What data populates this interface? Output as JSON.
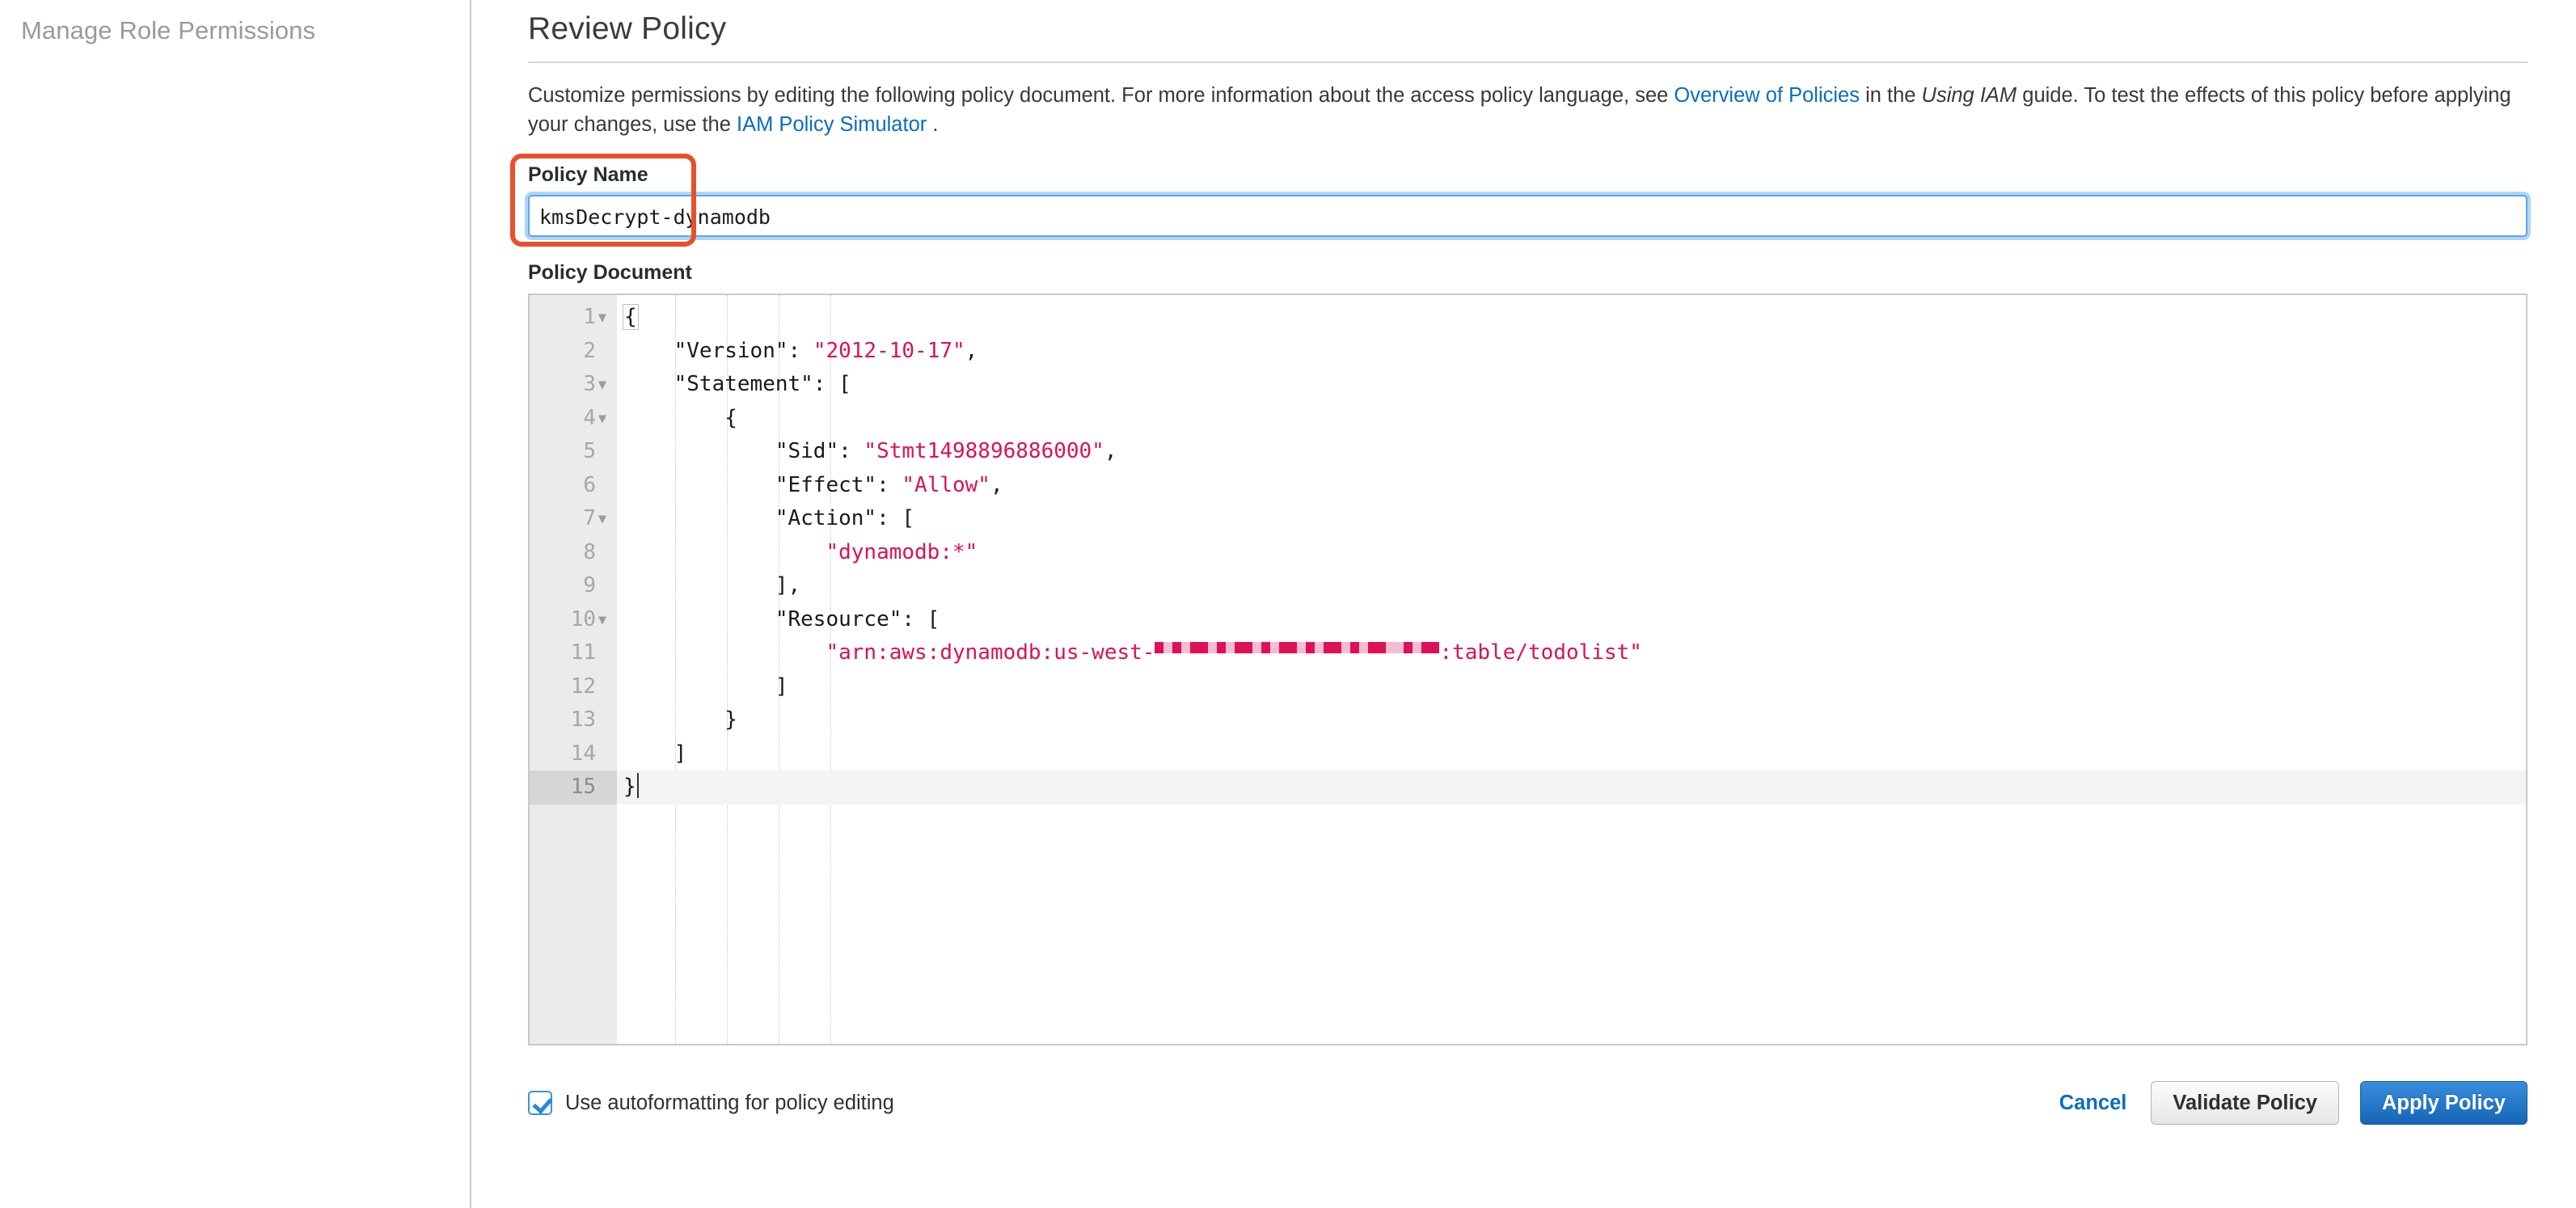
{
  "sidebar": {
    "title": "Manage Role Permissions"
  },
  "header": {
    "title": "Review Policy"
  },
  "description": {
    "part1": "Customize permissions by editing the following policy document. For more information about the access policy language, see ",
    "link1": "Overview of Policies",
    "part2": " in the ",
    "italic1": "Using IAM",
    "part3": " guide. To test the effects of this policy before applying your changes, use the ",
    "link2": "IAM Policy Simulator",
    "part4": " ."
  },
  "policy_name": {
    "label": "Policy Name",
    "value": "kmsDecrypt-dynamodb",
    "placeholder": "Policy Name"
  },
  "policy_document": {
    "label": "Policy Document",
    "lines": [
      {
        "n": "1",
        "fold": true,
        "active": false,
        "indent": 0,
        "pre": "{",
        "str": "",
        "post": ""
      },
      {
        "n": "2",
        "fold": false,
        "active": false,
        "indent": 1,
        "pre": "\"Version\": ",
        "str": "\"2012-10-17\"",
        "post": ","
      },
      {
        "n": "3",
        "fold": true,
        "active": false,
        "indent": 1,
        "pre": "\"Statement\": [",
        "str": "",
        "post": ""
      },
      {
        "n": "4",
        "fold": true,
        "active": false,
        "indent": 2,
        "pre": "{",
        "str": "",
        "post": ""
      },
      {
        "n": "5",
        "fold": false,
        "active": false,
        "indent": 3,
        "pre": "\"Sid\": ",
        "str": "\"Stmt1498896886000\"",
        "post": ","
      },
      {
        "n": "6",
        "fold": false,
        "active": false,
        "indent": 3,
        "pre": "\"Effect\": ",
        "str": "\"Allow\"",
        "post": ","
      },
      {
        "n": "7",
        "fold": true,
        "active": false,
        "indent": 3,
        "pre": "\"Action\": [",
        "str": "",
        "post": ""
      },
      {
        "n": "8",
        "fold": false,
        "active": false,
        "indent": 4,
        "pre": "",
        "str": "\"dynamodb:*\"",
        "post": ""
      },
      {
        "n": "9",
        "fold": false,
        "active": false,
        "indent": 3,
        "pre": "],",
        "str": "",
        "post": ""
      },
      {
        "n": "10",
        "fold": true,
        "active": false,
        "indent": 3,
        "pre": "\"Resource\": [",
        "str": "",
        "post": ""
      },
      {
        "n": "11",
        "fold": false,
        "active": false,
        "indent": 4,
        "pre": "",
        "str": "\"arn:aws:dynamodb:us-west-",
        "post": "",
        "redacted": true,
        "str_tail": ":table/todolist\""
      },
      {
        "n": "12",
        "fold": false,
        "active": false,
        "indent": 3,
        "pre": "]",
        "str": "",
        "post": ""
      },
      {
        "n": "13",
        "fold": false,
        "active": false,
        "indent": 2,
        "pre": "}",
        "str": "",
        "post": ""
      },
      {
        "n": "14",
        "fold": false,
        "active": false,
        "indent": 1,
        "pre": "]",
        "str": "",
        "post": ""
      },
      {
        "n": "15",
        "fold": false,
        "active": true,
        "indent": 0,
        "pre": "}",
        "str": "",
        "post": "",
        "caret": true
      }
    ]
  },
  "footer": {
    "autoformat_label": "Use autoformatting for policy editing",
    "autoformat_checked": true,
    "cancel_label": "Cancel",
    "validate_label": "Validate Policy",
    "apply_label": "Apply Policy"
  },
  "colors": {
    "link": "#0a6ebd",
    "string": "#dd1155",
    "annotation": "#e8502a",
    "primary_button": "#1565b5",
    "focus_ring": "#5aa7f0"
  }
}
